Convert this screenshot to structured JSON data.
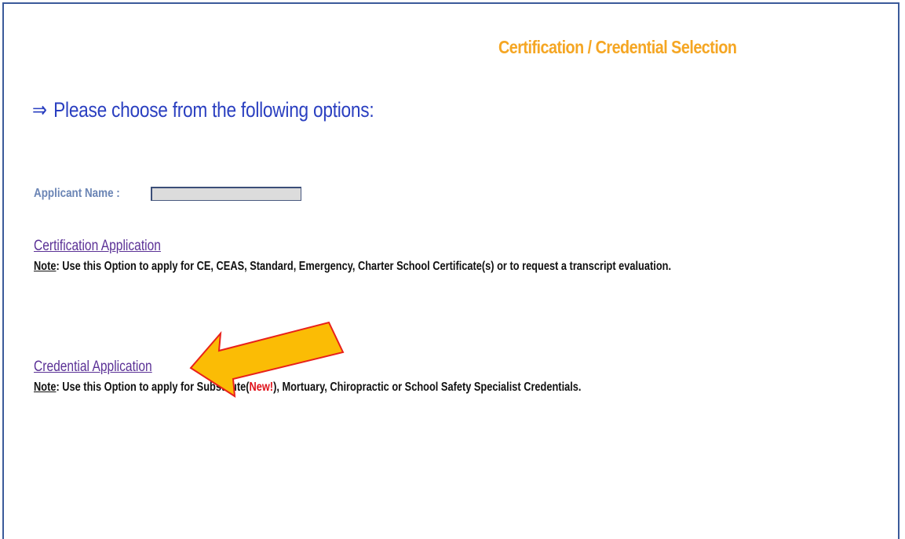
{
  "header": {
    "title": "Certification / Credential Selection"
  },
  "instruction": {
    "arrow": "⇒",
    "text": "Please choose from the following options:"
  },
  "applicant": {
    "label": "Applicant Name :",
    "value": ""
  },
  "certification": {
    "link_label": "Certification Application",
    "note_label": "Note",
    "note_text": ":  Use this Option to apply for CE, CEAS, Standard, Emergency, Charter School Certificate(s) or to request a transcript evaluation."
  },
  "credential": {
    "link_label": "Credential Application",
    "note_label": "Note",
    "note_text_before": ":  Use this Option to apply for Substitute(",
    "new_tag": "New!",
    "note_text_after": "), Mortuary, Chiropractic or School Safety Specialist Credentials."
  },
  "colors": {
    "title": "#f5a623",
    "instruction": "#2a3fc0",
    "label": "#6b85b5",
    "link": "#5b3196",
    "new_tag": "#e0121b",
    "callout_fill": "#fbbc05",
    "callout_stroke": "#e8201b",
    "frame_border": "#3b5a9a"
  },
  "icons": {
    "instruction_arrow": "double-right-arrow-icon",
    "callout": "callout-arrow-icon"
  }
}
